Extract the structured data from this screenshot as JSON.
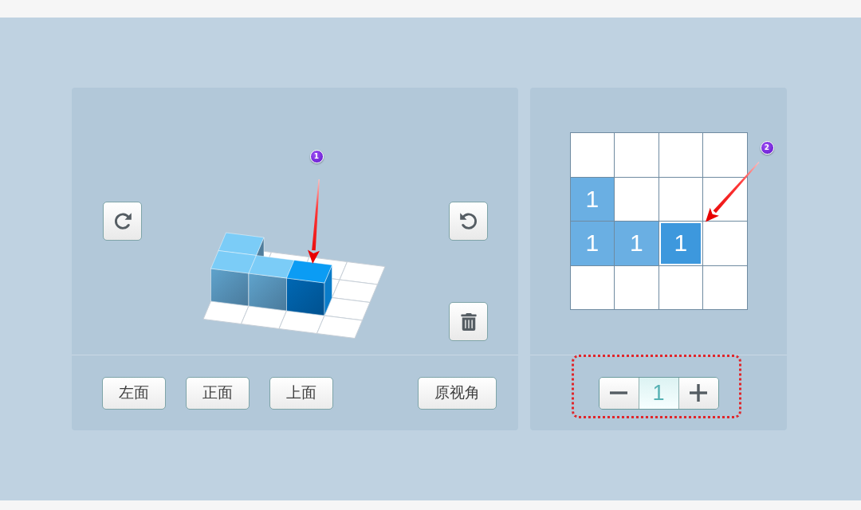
{
  "view_panel": {
    "annotation": {
      "label": "1"
    },
    "view_buttons": [
      {
        "label": "左面"
      },
      {
        "label": "正面"
      },
      {
        "label": "上面"
      }
    ],
    "reset_button": {
      "label": "原视角"
    }
  },
  "grid_panel": {
    "annotation": {
      "label": "2"
    },
    "rows": [
      {
        "cells": [
          {
            "filled": false,
            "selected": false
          },
          {
            "filled": false,
            "selected": false
          },
          {
            "filled": false,
            "selected": false
          },
          {
            "filled": false,
            "selected": false
          }
        ]
      },
      {
        "cells": [
          {
            "filled": true,
            "value": "1",
            "selected": false
          },
          {
            "filled": false,
            "selected": false
          },
          {
            "filled": false,
            "selected": false
          },
          {
            "filled": false,
            "selected": false
          }
        ]
      },
      {
        "cells": [
          {
            "filled": true,
            "value": "1",
            "selected": false
          },
          {
            "filled": true,
            "value": "1",
            "selected": false
          },
          {
            "filled": true,
            "value": "1",
            "selected": true
          },
          {
            "filled": false,
            "selected": false
          }
        ]
      },
      {
        "cells": [
          {
            "filled": false,
            "selected": false
          },
          {
            "filled": false,
            "selected": false
          },
          {
            "filled": false,
            "selected": false
          },
          {
            "filled": false,
            "selected": false
          }
        ]
      }
    ],
    "stepper": {
      "value": "1",
      "highlighted": true
    }
  }
}
